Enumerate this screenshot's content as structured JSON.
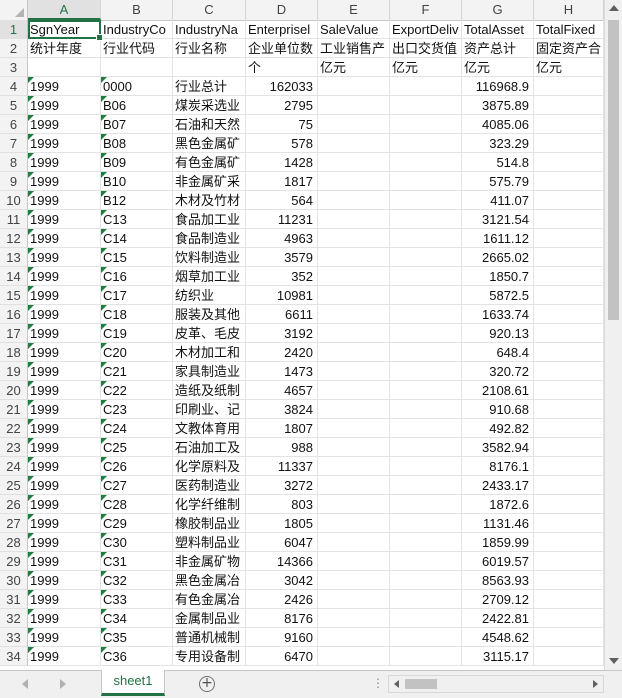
{
  "columns": [
    "A",
    "B",
    "C",
    "D",
    "E",
    "F",
    "G",
    "H"
  ],
  "active_column": "A",
  "rows": [
    {
      "n": "1",
      "cells": [
        "SgnYear",
        "IndustryCo",
        "IndustryNa",
        "Enterprisel",
        "SaleValue",
        "ExportDeliv",
        "TotalAsset",
        "TotalFixed"
      ]
    },
    {
      "n": "2",
      "cells": [
        "统计年度",
        "行业代码",
        "行业名称",
        "企业单位数",
        "工业销售产",
        "出口交货值",
        "资产总计",
        "固定资产合"
      ]
    },
    {
      "n": "3",
      "cells": [
        "",
        "",
        "",
        "个",
        "亿元",
        "亿元",
        "亿元",
        "亿元"
      ]
    },
    {
      "n": "4",
      "cells": [
        "1999",
        "0000",
        "行业总计",
        "162033",
        "",
        "",
        "116968.9",
        ""
      ]
    },
    {
      "n": "5",
      "cells": [
        "1999",
        "B06",
        "煤炭采选业",
        "2795",
        "",
        "",
        "3875.89",
        ""
      ]
    },
    {
      "n": "6",
      "cells": [
        "1999",
        "B07",
        "石油和天然",
        "75",
        "",
        "",
        "4085.06",
        ""
      ]
    },
    {
      "n": "7",
      "cells": [
        "1999",
        "B08",
        "黑色金属矿",
        "578",
        "",
        "",
        "323.29",
        ""
      ]
    },
    {
      "n": "8",
      "cells": [
        "1999",
        "B09",
        "有色金属矿",
        "1428",
        "",
        "",
        "514.8",
        ""
      ]
    },
    {
      "n": "9",
      "cells": [
        "1999",
        "B10",
        "非金属矿采",
        "1817",
        "",
        "",
        "575.79",
        ""
      ]
    },
    {
      "n": "10",
      "cells": [
        "1999",
        "B12",
        "木材及竹材",
        "564",
        "",
        "",
        "411.07",
        ""
      ]
    },
    {
      "n": "11",
      "cells": [
        "1999",
        "C13",
        "食品加工业",
        "11231",
        "",
        "",
        "3121.54",
        ""
      ]
    },
    {
      "n": "12",
      "cells": [
        "1999",
        "C14",
        "食品制造业",
        "4963",
        "",
        "",
        "1611.12",
        ""
      ]
    },
    {
      "n": "13",
      "cells": [
        "1999",
        "C15",
        "饮料制造业",
        "3579",
        "",
        "",
        "2665.02",
        ""
      ]
    },
    {
      "n": "14",
      "cells": [
        "1999",
        "C16",
        "烟草加工业",
        "352",
        "",
        "",
        "1850.7",
        ""
      ]
    },
    {
      "n": "15",
      "cells": [
        "1999",
        "C17",
        "纺织业",
        "10981",
        "",
        "",
        "5872.5",
        ""
      ]
    },
    {
      "n": "16",
      "cells": [
        "1999",
        "C18",
        "服装及其他",
        "6611",
        "",
        "",
        "1633.74",
        ""
      ]
    },
    {
      "n": "17",
      "cells": [
        "1999",
        "C19",
        "皮革、毛皮",
        "3192",
        "",
        "",
        "920.13",
        ""
      ]
    },
    {
      "n": "18",
      "cells": [
        "1999",
        "C20",
        "木材加工和",
        "2420",
        "",
        "",
        "648.4",
        ""
      ]
    },
    {
      "n": "19",
      "cells": [
        "1999",
        "C21",
        "家具制造业",
        "1473",
        "",
        "",
        "320.72",
        ""
      ]
    },
    {
      "n": "20",
      "cells": [
        "1999",
        "C22",
        "造纸及纸制",
        "4657",
        "",
        "",
        "2108.61",
        ""
      ]
    },
    {
      "n": "21",
      "cells": [
        "1999",
        "C23",
        "印刷业、记",
        "3824",
        "",
        "",
        "910.68",
        ""
      ]
    },
    {
      "n": "22",
      "cells": [
        "1999",
        "C24",
        "文教体育用",
        "1807",
        "",
        "",
        "492.82",
        ""
      ]
    },
    {
      "n": "23",
      "cells": [
        "1999",
        "C25",
        "石油加工及",
        "988",
        "",
        "",
        "3582.94",
        ""
      ]
    },
    {
      "n": "24",
      "cells": [
        "1999",
        "C26",
        "化学原料及",
        "11337",
        "",
        "",
        "8176.1",
        ""
      ]
    },
    {
      "n": "25",
      "cells": [
        "1999",
        "C27",
        "医药制造业",
        "3272",
        "",
        "",
        "2433.17",
        ""
      ]
    },
    {
      "n": "26",
      "cells": [
        "1999",
        "C28",
        "化学纤维制",
        "803",
        "",
        "",
        "1872.6",
        ""
      ]
    },
    {
      "n": "27",
      "cells": [
        "1999",
        "C29",
        "橡胶制品业",
        "1805",
        "",
        "",
        "1131.46",
        ""
      ]
    },
    {
      "n": "28",
      "cells": [
        "1999",
        "C30",
        "塑料制品业",
        "6047",
        "",
        "",
        "1859.99",
        ""
      ]
    },
    {
      "n": "29",
      "cells": [
        "1999",
        "C31",
        "非金属矿物",
        "14366",
        "",
        "",
        "6019.57",
        ""
      ]
    },
    {
      "n": "30",
      "cells": [
        "1999",
        "C32",
        "黑色金属冶",
        "3042",
        "",
        "",
        "8563.93",
        ""
      ]
    },
    {
      "n": "31",
      "cells": [
        "1999",
        "C33",
        "有色金属冶",
        "2426",
        "",
        "",
        "2709.12",
        ""
      ]
    },
    {
      "n": "32",
      "cells": [
        "1999",
        "C34",
        "金属制品业",
        "8176",
        "",
        "",
        "2422.81",
        ""
      ]
    },
    {
      "n": "33",
      "cells": [
        "1999",
        "C35",
        "普通机械制",
        "9160",
        "",
        "",
        "4548.62",
        ""
      ]
    },
    {
      "n": "34",
      "cells": [
        "1999",
        "C36",
        "专用设备制",
        "6470",
        "",
        "",
        "3115.17",
        ""
      ]
    }
  ],
  "sheet_tab": "sheet1",
  "add_sheet_symbol": "+",
  "dots": "⋮",
  "colors": {
    "accent": "#217346",
    "triangle": "#1e7e3e"
  }
}
